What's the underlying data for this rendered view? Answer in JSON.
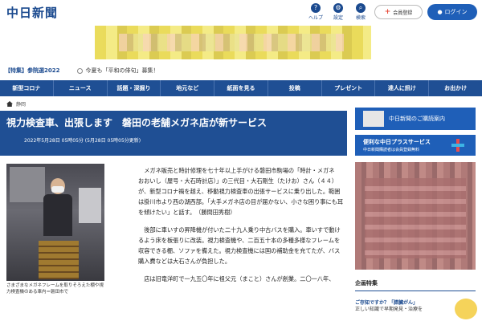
{
  "header": {
    "logo": "中日新聞",
    "icons": [
      {
        "name": "help-icon",
        "label": "ヘルプ",
        "glyph": "?"
      },
      {
        "name": "gear-icon",
        "label": "設定",
        "glyph": "⚙"
      },
      {
        "name": "search-icon",
        "label": "検索",
        "glyph": "⌕"
      }
    ],
    "register_label": "会員登録",
    "login_label": "ログイン"
  },
  "ticker": {
    "special": "【特集】参院選2022",
    "notice": "今夏も「平和の俳句」募集！"
  },
  "nav": {
    "items": [
      "新型コロナ",
      "ニュース",
      "話題・深掘り",
      "地元など",
      "紙面を見る",
      "投稿",
      "プレゼント",
      "達人に訊け",
      "お出かけ"
    ]
  },
  "breadcrumb": {
    "section": "静岡"
  },
  "article": {
    "title": "視力検査車、出張します　磐田の老舗メガネ店が新サービス",
    "date": "2022年5月28日 05時05分 (5月28日 05時05分更新)",
    "caption": "さまざまなメガネフレームを取りそろえた棚や視力検査機のある車内＝磐田市で",
    "paragraphs": [
      "メガネ販売と時計修理を七十年以上手がける磐田市駒場の「時計・メガネ　おおいし（屋号・大石時計店）」の三代目・大石剛生（たけお）さん（４４）が、新型コロナ禍を越え、移動視力検査車の出張サービスに乗り出した。範囲は掛川市より西の湖西部。「大手メガネ店の目が届かない、小さな困り事にも耳を傾けたい」と話す。　（勝間田秀樹）",
      "後部に車いすの昇降機が付いた二十九人乗り中古バスを購入。車いすで動けるよう床を板張りに改装。視力検査機や、二百五十本の多種多様なフレームを収容できる棚、ソファを備えた。視力検査機には国の補助金を充てたが、バス購入費などは大石さんが負担した。",
      "店は旧竜洋町で一九五〇年に祖父元（まこと）さんが創業。二〇一八年、"
    ]
  },
  "sidebar": {
    "card1": "中日新聞のご購読案内",
    "card2_title": "便利な中日プラスサービス",
    "card2_sub": "中日新聞購読者は会員登録無料",
    "section_head": "企画特集",
    "item_title": "ご存知ですか？「膵臓がん」",
    "item_body": "正しい知識で早期発見・治療を"
  },
  "colors": {
    "brand": "#1f4f94",
    "login": "#1f5fb8"
  }
}
